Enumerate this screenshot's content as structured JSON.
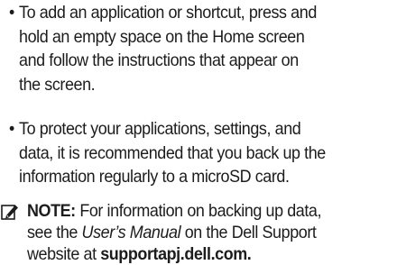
{
  "bullets": [
    {
      "lines": [
        "To add an application or shortcut, press and",
        "hold an empty space on the Home screen",
        "and follow the instructions that appear on",
        "the screen."
      ]
    },
    {
      "lines": [
        "To protect your applications, settings, and",
        "data, it is recommended that you back up the",
        "information regularly to a microSD card."
      ]
    }
  ],
  "bullet_glyph": "•",
  "note": {
    "icon": "pencil-note-icon",
    "label": "NOTE:",
    "line1_rest": " For information on backing up data,",
    "line2_before": "see the ",
    "line2_ital": "User’s Manual",
    "line2_after": " on the Dell Support",
    "line3_before": "website at ",
    "line3_bold": "supportapj.dell.com."
  }
}
